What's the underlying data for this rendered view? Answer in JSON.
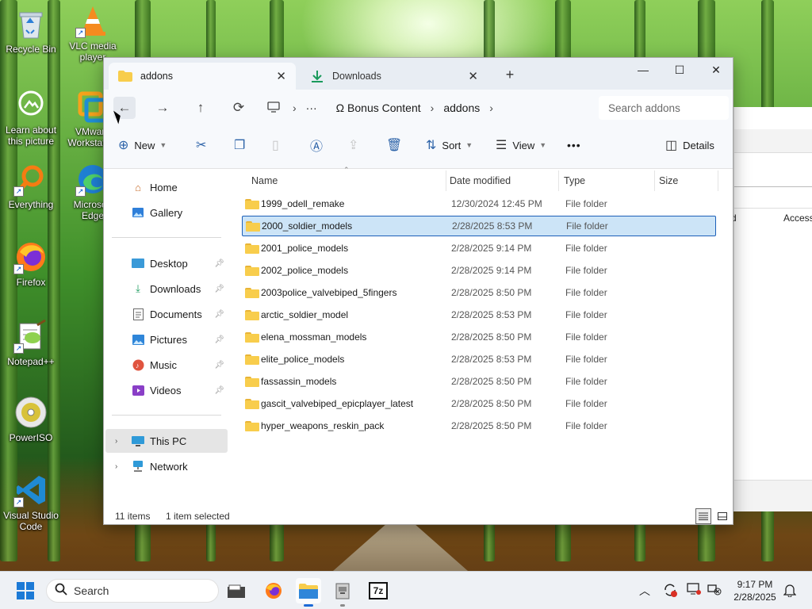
{
  "desktop": {
    "icons": [
      {
        "label": "Recycle Bin"
      },
      {
        "label": "VLC media player"
      },
      {
        "label": "Learn about this picture"
      },
      {
        "label": "VMware Workstation"
      },
      {
        "label": "Everything"
      },
      {
        "label": "Microsoft Edge"
      },
      {
        "label": "Firefox"
      },
      {
        "label": "Notepad++"
      },
      {
        "label": "PowerISO"
      },
      {
        "label": "Visual Studio Code"
      }
    ],
    "behind_window": {
      "col_partial": "d",
      "col_access": "Access"
    }
  },
  "explorer": {
    "tabs": [
      {
        "label": "addons",
        "icon": "folder-icon"
      },
      {
        "label": "Downloads",
        "icon": "download-icon"
      }
    ],
    "new_tab": "+",
    "window_controls": {
      "minimize": "—",
      "maximize": "☐",
      "close": "✕"
    },
    "nav_buttons": {
      "back": "←",
      "forward": "→",
      "up": "↑",
      "refresh": "⟳"
    },
    "breadcrumb": {
      "more": "···",
      "items": [
        "Ω Bonus Content",
        "addons"
      ]
    },
    "search_placeholder": "Search addons",
    "toolbar": {
      "new": "New",
      "sort": "Sort",
      "view": "View",
      "more": "•••",
      "details": "Details"
    },
    "sidebar": {
      "top": [
        {
          "label": "Home",
          "icon": "home-icon"
        },
        {
          "label": "Gallery",
          "icon": "gallery-icon"
        }
      ],
      "quick_access": [
        {
          "label": "Desktop",
          "icon": "desktop-icon"
        },
        {
          "label": "Downloads",
          "icon": "download-icon"
        },
        {
          "label": "Documents",
          "icon": "documents-icon"
        },
        {
          "label": "Pictures",
          "icon": "pictures-icon"
        },
        {
          "label": "Music",
          "icon": "music-icon"
        },
        {
          "label": "Videos",
          "icon": "videos-icon"
        }
      ],
      "bottom": [
        {
          "label": "This PC",
          "icon": "pc-icon"
        },
        {
          "label": "Network",
          "icon": "network-icon"
        }
      ]
    },
    "columns": {
      "name": "Name",
      "date": "Date modified",
      "type": "Type",
      "size": "Size"
    },
    "files": [
      {
        "name": "1999_odell_remake",
        "date": "12/30/2024 12:45 PM",
        "type": "File folder"
      },
      {
        "name": "2000_soldier_models",
        "date": "2/28/2025 8:53 PM",
        "type": "File folder"
      },
      {
        "name": "2001_police_models",
        "date": "2/28/2025 9:14 PM",
        "type": "File folder"
      },
      {
        "name": "2002_police_models",
        "date": "2/28/2025 9:14 PM",
        "type": "File folder"
      },
      {
        "name": "2003police_valvebiped_5fingers",
        "date": "2/28/2025 8:50 PM",
        "type": "File folder"
      },
      {
        "name": "arctic_soldier_model",
        "date": "2/28/2025 8:53 PM",
        "type": "File folder"
      },
      {
        "name": "elena_mossman_models",
        "date": "2/28/2025 8:50 PM",
        "type": "File folder"
      },
      {
        "name": "elite_police_models",
        "date": "2/28/2025 8:53 PM",
        "type": "File folder"
      },
      {
        "name": "fassassin_models",
        "date": "2/28/2025 8:50 PM",
        "type": "File folder"
      },
      {
        "name": "gascit_valvebiped_epicplayer_latest",
        "date": "2/28/2025 8:50 PM",
        "type": "File folder"
      },
      {
        "name": "hyper_weapons_reskin_pack",
        "date": "2/28/2025 8:50 PM",
        "type": "File folder"
      }
    ],
    "status": {
      "items": "11 items",
      "selected": "1 item selected"
    }
  },
  "taskbar": {
    "search_label": "Search",
    "apps": [
      "file-explorer-icon",
      "firefox-icon",
      "windows-explorer-icon",
      "archive-tool-icon",
      "7zip-icon"
    ],
    "sevenzip_label": "7z",
    "clock": {
      "time": "9:17 PM",
      "date": "2/28/2025"
    }
  },
  "colors": {
    "accent": "#1c5fb8",
    "selection": "#cce4f7",
    "folder": "#f8cd4c"
  }
}
